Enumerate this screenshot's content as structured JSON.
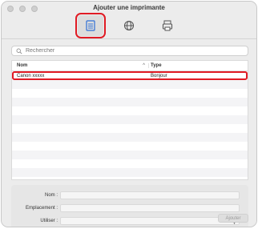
{
  "window": {
    "title": "Ajouter une imprimante"
  },
  "toolbar": {
    "items": [
      {
        "icon": "printer-icon",
        "selected": true
      },
      {
        "icon": "globe-icon",
        "selected": false
      },
      {
        "icon": "printer-alt-icon",
        "selected": false
      }
    ]
  },
  "search": {
    "placeholder": "Rechercher"
  },
  "table": {
    "headers": {
      "name": "Nom",
      "type": "Type"
    },
    "sort_indicator": "^",
    "rows": [
      {
        "name": "Canon xxxxx",
        "type": "Bonjour"
      }
    ]
  },
  "form": {
    "name_label": "Nom :",
    "location_label": "Emplacement :",
    "use_label": "Utiliser :",
    "name_value": "",
    "location_value": "",
    "use_value": ""
  },
  "actions": {
    "add_label": "Ajouter"
  },
  "colors": {
    "highlight": "#e01b24",
    "window_bg": "#ececec"
  }
}
